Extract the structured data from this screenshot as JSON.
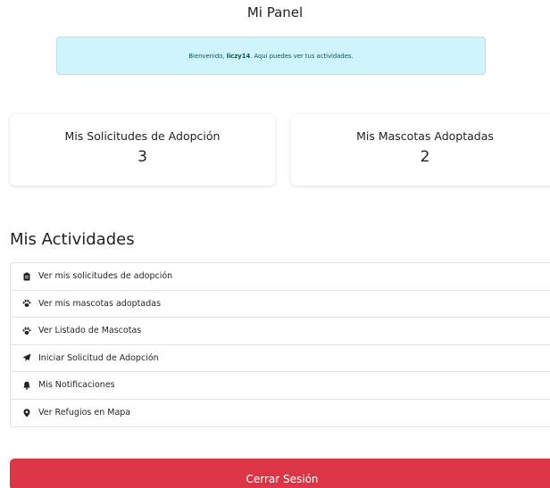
{
  "header": {
    "title": "Mi Panel"
  },
  "welcome": {
    "prefix": "Bienvenido,",
    "username": "liczy14",
    "suffix": ". Aquí puedes ver tus actividades."
  },
  "stats": {
    "adoption_requests": {
      "label": "Mis Solicitudes de Adopción",
      "value": "3"
    },
    "adopted_pets": {
      "label": "Mis Mascotas Adoptadas",
      "value": "2"
    }
  },
  "activities": {
    "title": "Mis Actividades",
    "items": [
      {
        "label": "Ver mis solicitudes de adopción",
        "icon": "clipboard-icon"
      },
      {
        "label": "Ver mis mascotas adoptadas",
        "icon": "paw-icon"
      },
      {
        "label": "Ver Listado de Mascotas",
        "icon": "paw-icon"
      },
      {
        "label": "Iniciar Solicitud de Adopción",
        "icon": "paper-plane-icon"
      },
      {
        "label": "Mis Notificaciones",
        "icon": "bell-icon"
      },
      {
        "label": "Ver Refugios en Mapa",
        "icon": "map-marker-icon"
      }
    ]
  },
  "logout": {
    "label": "Cerrar Sesión"
  },
  "colors": {
    "alert_bg": "#cff4fc",
    "alert_text": "#055160",
    "danger": "#dc3545"
  }
}
